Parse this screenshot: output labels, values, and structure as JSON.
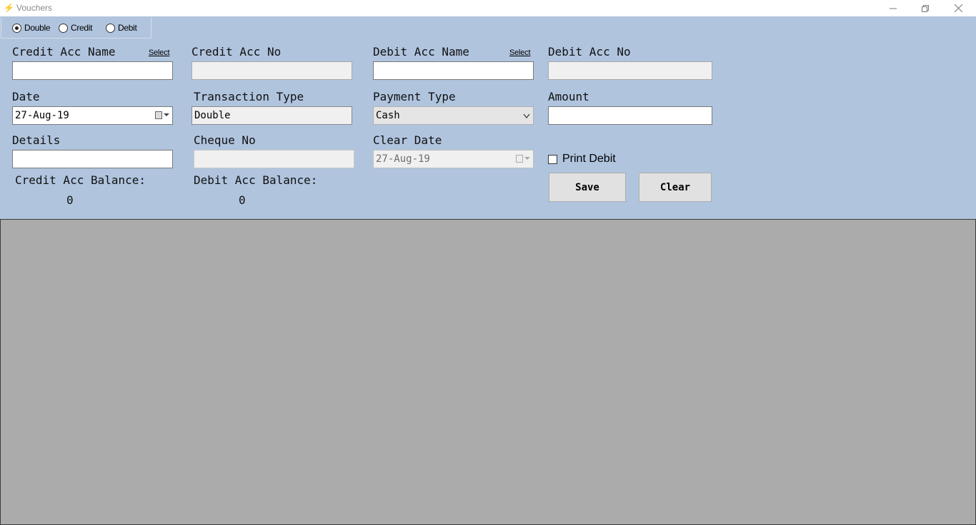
{
  "window": {
    "title": "Vouchers",
    "minimize_icon": "minimize-icon",
    "maximize_icon": "restore-icon",
    "close_icon": "close-icon"
  },
  "mode": {
    "options": [
      {
        "label": "Double",
        "selected": true
      },
      {
        "label": "Credit",
        "selected": false
      },
      {
        "label": "Debit",
        "selected": false
      }
    ]
  },
  "credit_acc_name": {
    "label": "Credit Acc Name",
    "link": "Select",
    "value": ""
  },
  "credit_acc_no": {
    "label": "Credit Acc No",
    "value": ""
  },
  "debit_acc_name": {
    "label": "Debit Acc Name",
    "link": "Select",
    "value": ""
  },
  "debit_acc_no": {
    "label": "Debit Acc No",
    "value": ""
  },
  "date": {
    "label": "Date",
    "value": "27-Aug-19"
  },
  "transaction_type": {
    "label": "Transaction Type",
    "value": "Double"
  },
  "payment_type": {
    "label": "Payment Type",
    "value": "Cash"
  },
  "amount": {
    "label": "Amount",
    "value": ""
  },
  "details": {
    "label": "Details",
    "value": ""
  },
  "cheque_no": {
    "label": "Cheque No",
    "value": ""
  },
  "clear_date": {
    "label": "Clear Date",
    "value": "27-Aug-19"
  },
  "print_debit": {
    "label": "Print Debit",
    "checked": false
  },
  "credit_balance": {
    "label": "Credit Acc Balance:",
    "value": "0"
  },
  "debit_balance": {
    "label": "Debit Acc Balance:",
    "value": "0"
  },
  "buttons": {
    "save": "Save",
    "clear": "Clear"
  },
  "colors": {
    "form_bg": "#b0c4de",
    "grid_bg": "#ababab"
  }
}
